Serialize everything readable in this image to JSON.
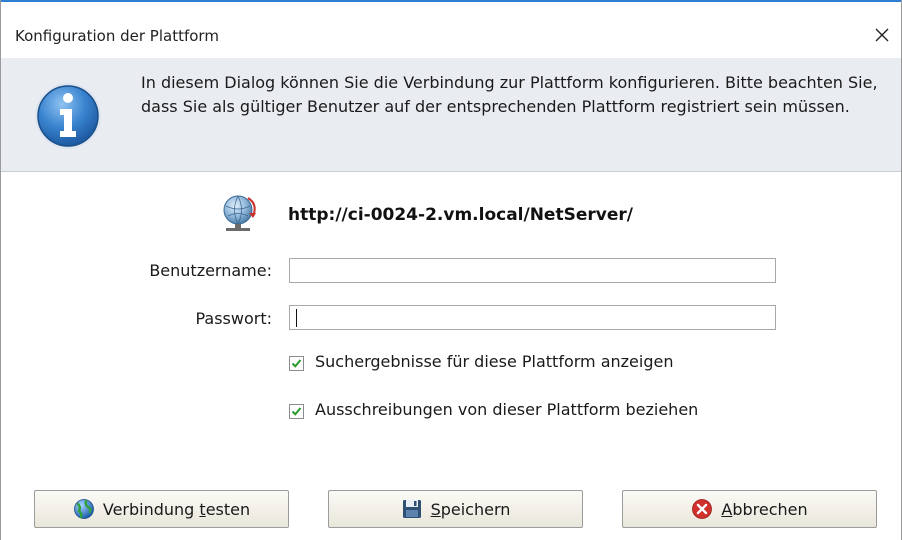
{
  "window": {
    "title": "Konfiguration der Plattform",
    "close_glyph": "✕"
  },
  "banner": {
    "icon": "info-icon",
    "text": "In diesem Dialog können Sie die Verbindung zur Plattform konfigurieren. Bitte beachten Sie, dass Sie als gültiger Benutzer auf der entsprechenden Plattform registriert sein müssen."
  },
  "platform": {
    "icon": "globe-network-icon",
    "url": "http://ci-0024-2.vm.local/NetServer/"
  },
  "form": {
    "username_label": "Benutzername:",
    "username_value": "",
    "password_label": "Passwort:",
    "password_value": ""
  },
  "options": [
    {
      "label": "Suchergebnisse für diese Plattform anzeigen",
      "checked": true
    },
    {
      "label": "Ausschreibungen von dieser Plattform beziehen",
      "checked": true
    }
  ],
  "buttons": {
    "test": {
      "label_pre": "Verbindung ",
      "label_underline": "t",
      "label_post": "esten",
      "icon": "globe-icon"
    },
    "save": {
      "label_pre": "",
      "label_underline": "S",
      "label_post": "peichern",
      "icon": "floppy-disk-icon"
    },
    "cancel": {
      "label_pre": "",
      "label_underline": "A",
      "label_post": "bbrechen",
      "icon": "cancel-x-icon"
    }
  },
  "colors": {
    "title_accent": "#2f7fd3",
    "banner_bg": "#e9edf2",
    "checkbox_check": "#2a9a2a",
    "cancel_red": "#d0312d"
  }
}
